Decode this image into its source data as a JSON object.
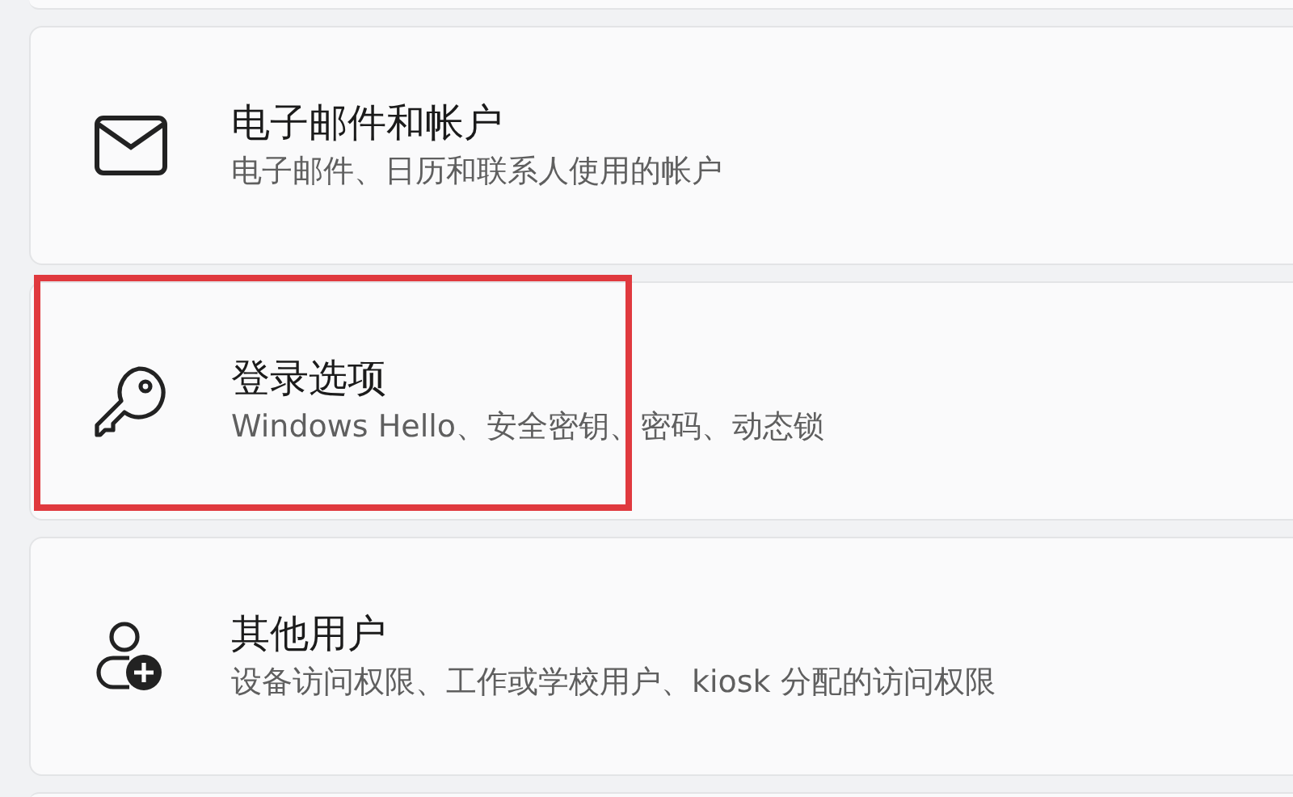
{
  "items": [
    {
      "title": "电子邮件和帐户",
      "subtitle": "电子邮件、日历和联系人使用的帐户",
      "highlighted": false
    },
    {
      "title": "登录选项",
      "subtitle": "Windows Hello、安全密钥、密码、动态锁",
      "highlighted": true
    },
    {
      "title": "其他用户",
      "subtitle": "设备访问权限、工作或学校用户、kiosk 分配的访问权限",
      "highlighted": false
    }
  ]
}
